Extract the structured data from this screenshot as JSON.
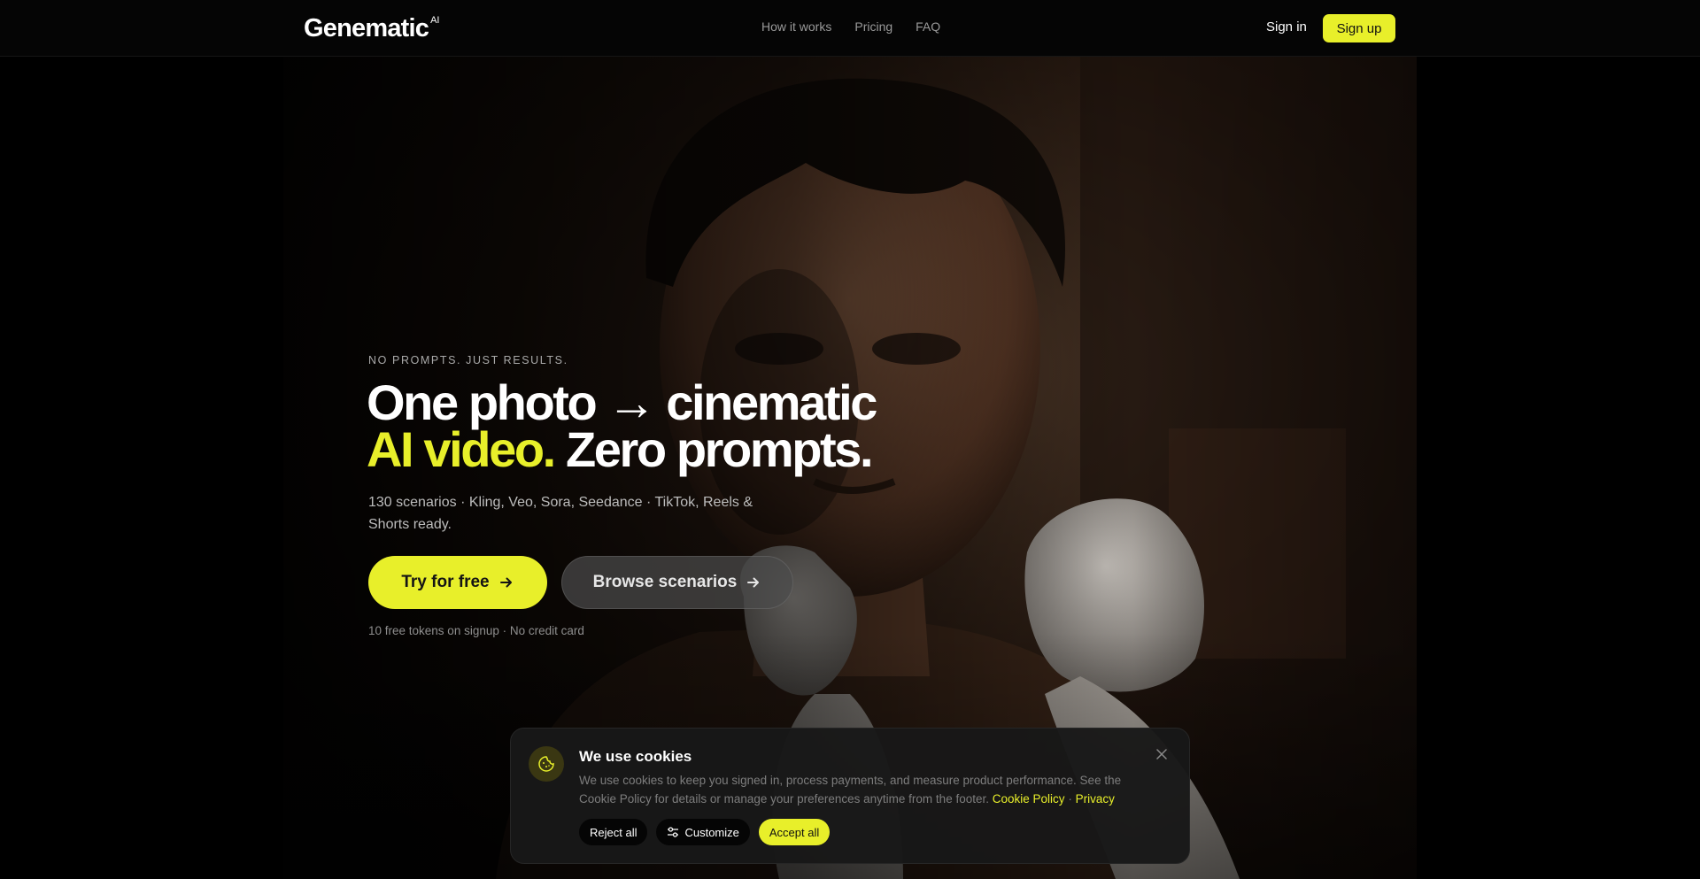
{
  "header": {
    "logo": "Genematic",
    "logo_sup": "AI",
    "nav": [
      "How it works",
      "Pricing",
      "FAQ"
    ],
    "signin_label": "Sign in",
    "signup_label": "Sign up"
  },
  "hero": {
    "eyebrow": "NO PROMPTS. JUST RESULTS.",
    "headline_line1": "One photo → cinematic",
    "headline_accent": "AI video.",
    "headline_rest": " Zero prompts.",
    "subline": "130 scenarios · Kling, Veo, Sora, Seedance · TikTok, Reels & Shorts ready.",
    "primary_cta": "Try for free",
    "secondary_cta": "Browse scenarios",
    "note": "10 free tokens on signup · No credit card"
  },
  "cookie_banner": {
    "title": "We use cookies",
    "body": "We use cookies to keep you signed in, process payments, and measure product performance. See the Cookie Policy for details or manage your preferences anytime from the footer.",
    "link_policy": "Cookie Policy",
    "link_privacy": "Privacy",
    "reject_label": "Reject all",
    "customize_label": "Customize",
    "accept_label": "Accept all"
  },
  "colors": {
    "accent": "#e8ef2a",
    "background": "#000000"
  },
  "icons": [
    "arrow-right-icon",
    "cookie-icon",
    "close-icon",
    "sliders-icon"
  ]
}
